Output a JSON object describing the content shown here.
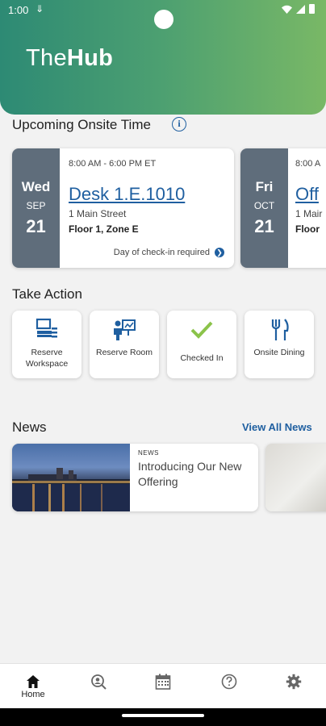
{
  "status_bar": {
    "time": "1:00",
    "sync_icon": "sync-icon"
  },
  "header": {
    "brand_part1": "The",
    "brand_part2": "Hub"
  },
  "onsite": {
    "title": "Upcoming Onsite Time",
    "cards": [
      {
        "dow": "Wed",
        "month": "SEP",
        "day": "21",
        "time": "8:00 AM - 6:00 PM ET",
        "location": "Desk 1.E.1010",
        "address": "1 Main Street",
        "floor": "Floor 1, Zone E",
        "checkin_note": "Day of check-in required"
      },
      {
        "dow": "Fri",
        "month": "OCT",
        "day": "21",
        "time": "8:00 A",
        "location": "Off",
        "address": "1 Mair",
        "floor": "Floor"
      }
    ]
  },
  "take_action": {
    "title": "Take Action",
    "items": [
      {
        "label": "Reserve Workspace",
        "icon": "workspace-icon"
      },
      {
        "label": "Reserve Room",
        "icon": "presentation-room-icon"
      },
      {
        "label": "Checked In",
        "icon": "checkmark-icon"
      },
      {
        "label": "Onsite Dining",
        "icon": "fork-knife-icon"
      }
    ]
  },
  "news": {
    "title": "News",
    "view_all": "View All News",
    "items": [
      {
        "tag": "NEWS",
        "title": "Introducing Our New Offering"
      }
    ]
  },
  "bottom_nav": {
    "items": [
      {
        "label": "Home",
        "icon": "home-icon"
      },
      {
        "label": "",
        "icon": "search-person-icon"
      },
      {
        "label": "",
        "icon": "calendar-icon"
      },
      {
        "label": "",
        "icon": "help-icon"
      },
      {
        "label": "",
        "icon": "gear-icon"
      }
    ]
  },
  "colors": {
    "accent_blue": "#1f5fa0",
    "date_panel": "#5f6d7b",
    "header_start": "#2d8a74",
    "header_end": "#79b866",
    "check_green": "#8bc34a"
  }
}
